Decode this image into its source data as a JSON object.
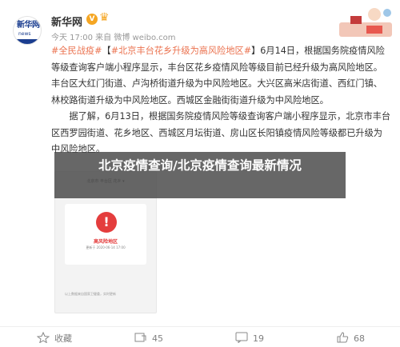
{
  "account": {
    "name": "新华网",
    "verified_badge": "V",
    "meta": "今天 17:00 来自 微博 weibo.com",
    "avatar_text": "新华网",
    "avatar_sub": "news"
  },
  "post": {
    "hashtag1": "#全民战疫#",
    "bracket": "【",
    "hashtag2": "#北京丰台花乡升级为高风险地区#",
    "para1_rest": "】6月14日，根据国务院疫情风险等级查询客户端小程序显示，丰台区花乡疫情风险等级目前已经升级为高风险地区。丰台区大红门街道、卢沟桥街道升级为中风险地区。大兴区高米店街道、西红门镇、林校路街道升级为中风险地区。西城区金融街街道升级为中风险地区。",
    "para2": "据了解，6月13日，根据国务院疫情风险等级查询客户端小程序显示，北京市丰台区西罗园街道、花乡地区、西城区月坛街道、房山区长阳镇疫情风险等级都已升级为中风险地区。"
  },
  "overlay": {
    "title": "北京疫情查询/北京疫情查询最新情况"
  },
  "screenshot": {
    "top_text": "北京市 丰台区 花乡 ▾",
    "warn_glyph": "!",
    "risk_label": "高风险地区",
    "risk_date": "更新于 2020-06-14 17:00",
    "foot_text": "以上数据来自国家卫健委，实时更新"
  },
  "toolbar": {
    "forward": "收藏",
    "comment": "45",
    "like": "19",
    "like2": "68"
  },
  "colors": {
    "hashtag": "#eb7350",
    "link": "#5d81b7",
    "badge": "#f5a623",
    "risk": "#e43d3d"
  }
}
